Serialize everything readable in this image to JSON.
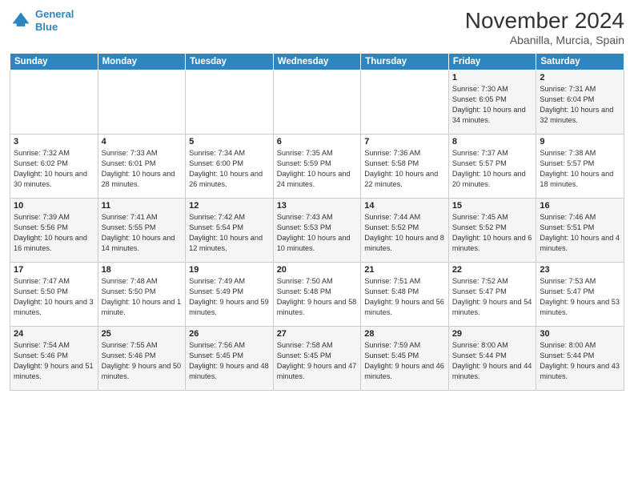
{
  "header": {
    "logo_line1": "General",
    "logo_line2": "Blue",
    "month": "November 2024",
    "location": "Abanilla, Murcia, Spain"
  },
  "weekdays": [
    "Sunday",
    "Monday",
    "Tuesday",
    "Wednesday",
    "Thursday",
    "Friday",
    "Saturday"
  ],
  "weeks": [
    [
      {
        "day": "",
        "info": ""
      },
      {
        "day": "",
        "info": ""
      },
      {
        "day": "",
        "info": ""
      },
      {
        "day": "",
        "info": ""
      },
      {
        "day": "",
        "info": ""
      },
      {
        "day": "1",
        "info": "Sunrise: 7:30 AM\nSunset: 6:05 PM\nDaylight: 10 hours and 34 minutes."
      },
      {
        "day": "2",
        "info": "Sunrise: 7:31 AM\nSunset: 6:04 PM\nDaylight: 10 hours and 32 minutes."
      }
    ],
    [
      {
        "day": "3",
        "info": "Sunrise: 7:32 AM\nSunset: 6:02 PM\nDaylight: 10 hours and 30 minutes."
      },
      {
        "day": "4",
        "info": "Sunrise: 7:33 AM\nSunset: 6:01 PM\nDaylight: 10 hours and 28 minutes."
      },
      {
        "day": "5",
        "info": "Sunrise: 7:34 AM\nSunset: 6:00 PM\nDaylight: 10 hours and 26 minutes."
      },
      {
        "day": "6",
        "info": "Sunrise: 7:35 AM\nSunset: 5:59 PM\nDaylight: 10 hours and 24 minutes."
      },
      {
        "day": "7",
        "info": "Sunrise: 7:36 AM\nSunset: 5:58 PM\nDaylight: 10 hours and 22 minutes."
      },
      {
        "day": "8",
        "info": "Sunrise: 7:37 AM\nSunset: 5:57 PM\nDaylight: 10 hours and 20 minutes."
      },
      {
        "day": "9",
        "info": "Sunrise: 7:38 AM\nSunset: 5:57 PM\nDaylight: 10 hours and 18 minutes."
      }
    ],
    [
      {
        "day": "10",
        "info": "Sunrise: 7:39 AM\nSunset: 5:56 PM\nDaylight: 10 hours and 16 minutes."
      },
      {
        "day": "11",
        "info": "Sunrise: 7:41 AM\nSunset: 5:55 PM\nDaylight: 10 hours and 14 minutes."
      },
      {
        "day": "12",
        "info": "Sunrise: 7:42 AM\nSunset: 5:54 PM\nDaylight: 10 hours and 12 minutes."
      },
      {
        "day": "13",
        "info": "Sunrise: 7:43 AM\nSunset: 5:53 PM\nDaylight: 10 hours and 10 minutes."
      },
      {
        "day": "14",
        "info": "Sunrise: 7:44 AM\nSunset: 5:52 PM\nDaylight: 10 hours and 8 minutes."
      },
      {
        "day": "15",
        "info": "Sunrise: 7:45 AM\nSunset: 5:52 PM\nDaylight: 10 hours and 6 minutes."
      },
      {
        "day": "16",
        "info": "Sunrise: 7:46 AM\nSunset: 5:51 PM\nDaylight: 10 hours and 4 minutes."
      }
    ],
    [
      {
        "day": "17",
        "info": "Sunrise: 7:47 AM\nSunset: 5:50 PM\nDaylight: 10 hours and 3 minutes."
      },
      {
        "day": "18",
        "info": "Sunrise: 7:48 AM\nSunset: 5:50 PM\nDaylight: 10 hours and 1 minute."
      },
      {
        "day": "19",
        "info": "Sunrise: 7:49 AM\nSunset: 5:49 PM\nDaylight: 9 hours and 59 minutes."
      },
      {
        "day": "20",
        "info": "Sunrise: 7:50 AM\nSunset: 5:48 PM\nDaylight: 9 hours and 58 minutes."
      },
      {
        "day": "21",
        "info": "Sunrise: 7:51 AM\nSunset: 5:48 PM\nDaylight: 9 hours and 56 minutes."
      },
      {
        "day": "22",
        "info": "Sunrise: 7:52 AM\nSunset: 5:47 PM\nDaylight: 9 hours and 54 minutes."
      },
      {
        "day": "23",
        "info": "Sunrise: 7:53 AM\nSunset: 5:47 PM\nDaylight: 9 hours and 53 minutes."
      }
    ],
    [
      {
        "day": "24",
        "info": "Sunrise: 7:54 AM\nSunset: 5:46 PM\nDaylight: 9 hours and 51 minutes."
      },
      {
        "day": "25",
        "info": "Sunrise: 7:55 AM\nSunset: 5:46 PM\nDaylight: 9 hours and 50 minutes."
      },
      {
        "day": "26",
        "info": "Sunrise: 7:56 AM\nSunset: 5:45 PM\nDaylight: 9 hours and 48 minutes."
      },
      {
        "day": "27",
        "info": "Sunrise: 7:58 AM\nSunset: 5:45 PM\nDaylight: 9 hours and 47 minutes."
      },
      {
        "day": "28",
        "info": "Sunrise: 7:59 AM\nSunset: 5:45 PM\nDaylight: 9 hours and 46 minutes."
      },
      {
        "day": "29",
        "info": "Sunrise: 8:00 AM\nSunset: 5:44 PM\nDaylight: 9 hours and 44 minutes."
      },
      {
        "day": "30",
        "info": "Sunrise: 8:00 AM\nSunset: 5:44 PM\nDaylight: 9 hours and 43 minutes."
      }
    ]
  ]
}
